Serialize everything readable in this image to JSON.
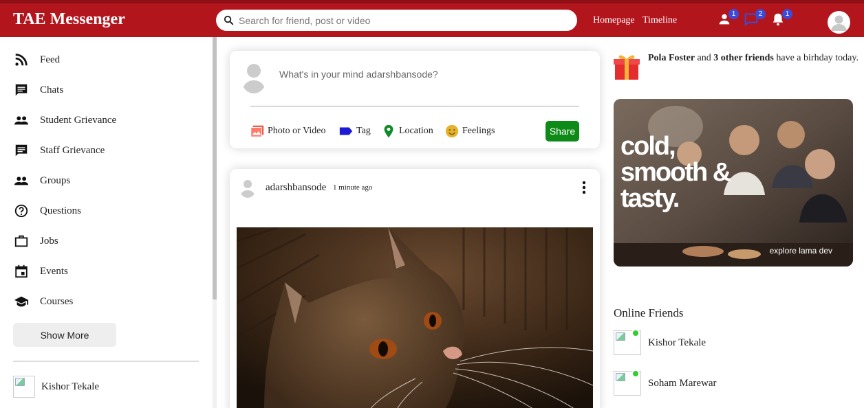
{
  "app": {
    "title": "TAE Messenger"
  },
  "search": {
    "placeholder": "Search for friend, post or video"
  },
  "nav": {
    "links": [
      "Homepage",
      "Timeline"
    ]
  },
  "notifications": {
    "friend_requests": "1",
    "messages": "2",
    "alerts": "1"
  },
  "colors": {
    "topbar": "#b3151d",
    "share": "#0e8a17",
    "badge": "#3b4bd8",
    "online": "#32cd32"
  },
  "sidebar": {
    "items": [
      {
        "label": "Feed",
        "icon": "rss-icon"
      },
      {
        "label": "Chats",
        "icon": "chat-icon"
      },
      {
        "label": "Student Grievance",
        "icon": "group-icon"
      },
      {
        "label": "Staff Grievance",
        "icon": "chat-icon"
      },
      {
        "label": "Groups",
        "icon": "group-icon"
      },
      {
        "label": "Questions",
        "icon": "help-circle-icon"
      },
      {
        "label": "Jobs",
        "icon": "briefcase-icon"
      },
      {
        "label": "Events",
        "icon": "calendar-icon"
      },
      {
        "label": "Courses",
        "icon": "graduation-cap-icon"
      }
    ],
    "show_more": "Show More",
    "friends": [
      "Kishor Tekale"
    ]
  },
  "share": {
    "placeholder": "What's in your mind adarshbansode?",
    "options": [
      {
        "label": "Photo or Video",
        "icon": "photo-icon"
      },
      {
        "label": "Tag",
        "icon": "label-icon"
      },
      {
        "label": "Location",
        "icon": "location-pin-icon"
      },
      {
        "label": "Feelings",
        "icon": "emoji-icon"
      }
    ],
    "button": "Share"
  },
  "post": {
    "username": "adarshbansode",
    "time": "1 minute ago"
  },
  "birthday": {
    "name": "Pola Foster",
    "connector": " and ",
    "others": "3 other friends",
    "rest": " have a birhday today."
  },
  "ad": {
    "headline": "cold, smooth & tasty.",
    "footer": "explore lama dev"
  },
  "online": {
    "title": "Online Friends",
    "friends": [
      "Kishor Tekale",
      "Soham Marewar"
    ]
  }
}
